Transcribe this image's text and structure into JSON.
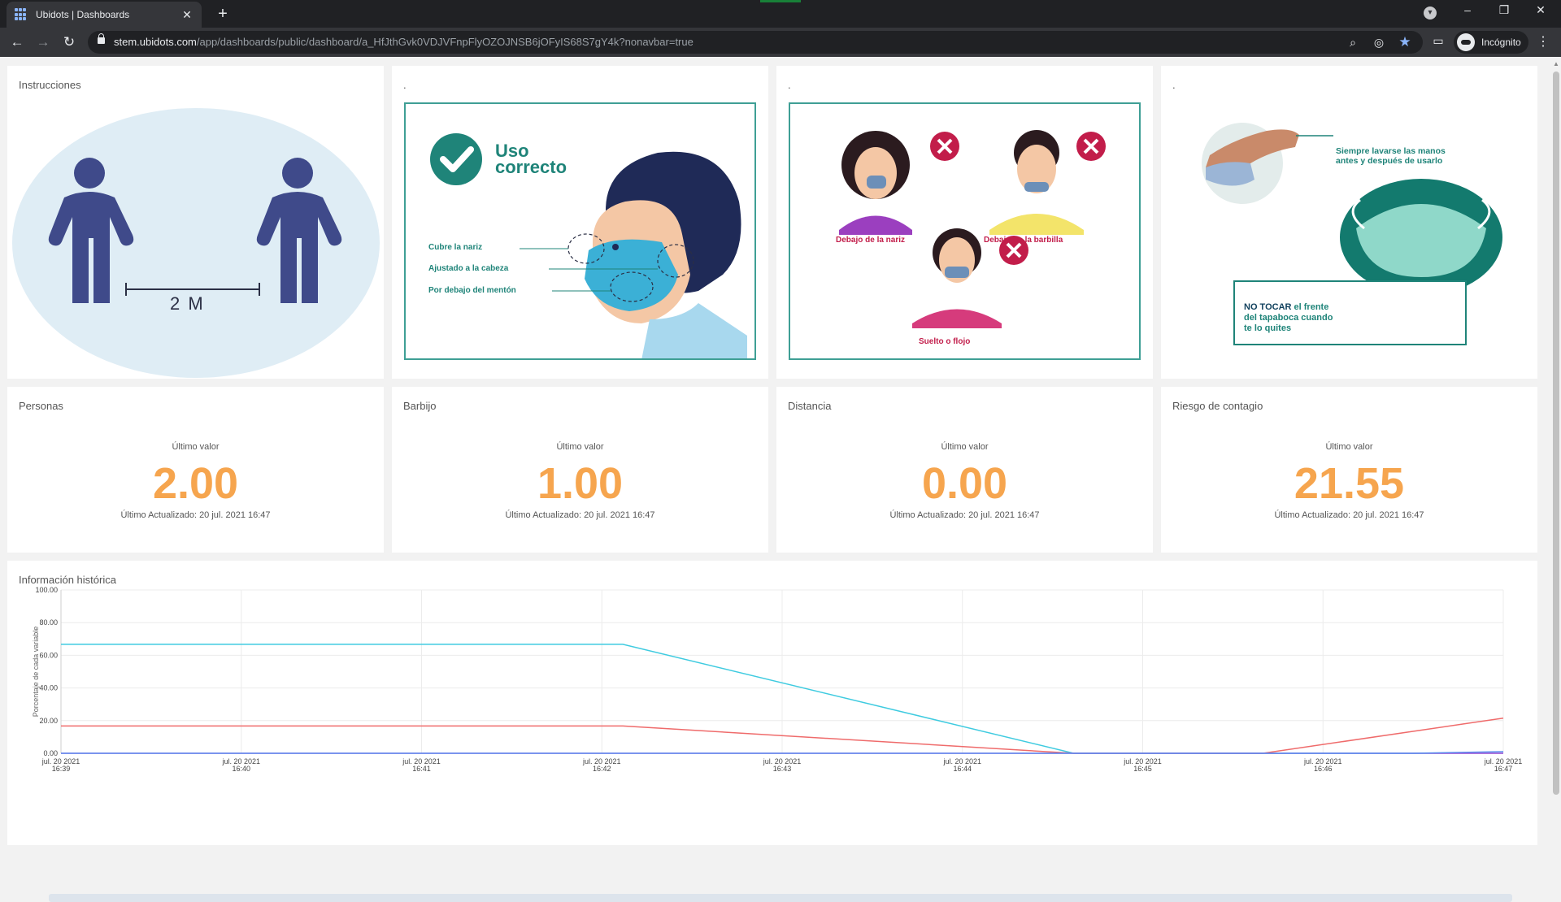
{
  "browser": {
    "tab_title": "Ubidots | Dashboards",
    "tab_close": "✕",
    "new_tab": "+",
    "url_host": "stem.ubidots.com",
    "url_path": "/app/dashboards/public/dashboard/a_HfJthGvk0VDJVFnpFlyOZOJNSB6jOFyIS68S7gY4k?nonavbar=true",
    "profile_label": "Incógnito",
    "window_minimize": "–",
    "window_restore": "❐",
    "window_close": "✕"
  },
  "widgets": {
    "instrucciones": {
      "title": "Instrucciones",
      "distance_label": "2 M"
    },
    "uso_correcto": {
      "title": ".",
      "heading_line1": "Uso",
      "heading_line2": "correcto",
      "label_1": "Cubre la nariz",
      "label_2": "Ajustado a la cabeza",
      "label_3": "Por debajo del mentón"
    },
    "uso_incorrecto": {
      "title": ".",
      "label_1": "Debajo de la nariz",
      "label_2": "Debajo de la barbilla",
      "label_3": "Suelto o flojo"
    },
    "lavado": {
      "title": ".",
      "note_top_1": "Siempre lavarse las manos",
      "note_top_2": "antes y después de usarlo",
      "note_bottom_bold": "NO TOCAR",
      "note_bottom_1": " el frente",
      "note_bottom_2": "del tapaboca cuando",
      "note_bottom_3": "te lo quites"
    }
  },
  "metrics": [
    {
      "title": "Personas",
      "sub": "Último valor",
      "value": "2.00",
      "updated": "Último Actualizado: 20 jul. 2021 16:47"
    },
    {
      "title": "Barbijo",
      "sub": "Último valor",
      "value": "1.00",
      "updated": "Último Actualizado: 20 jul. 2021 16:47"
    },
    {
      "title": "Distancia",
      "sub": "Último valor",
      "value": "0.00",
      "updated": "Último Actualizado: 20 jul. 2021 16:47"
    },
    {
      "title": "Riesgo de contagio",
      "sub": "Último valor",
      "value": "21.55",
      "updated": "Último Actualizado: 20 jul. 2021 16:47"
    }
  ],
  "history": {
    "title": "Información histórica"
  },
  "colors": {
    "accent_value": "#f6a54e",
    "frame_teal": "#3f9f95",
    "series_cyan": "#3fcbe0",
    "series_red": "#ef6b6b",
    "series_purple": "#b04fd6",
    "series_blue": "#5b8def"
  },
  "chart_data": {
    "type": "line",
    "title": "Información histórica",
    "ylabel": "Porcentaje de cada variable",
    "xlabel": "",
    "ylim": [
      0,
      100
    ],
    "y_ticks": [
      "100.00",
      "80.00",
      "60.00",
      "40.00",
      "20.00",
      "0.00"
    ],
    "x_ticks": [
      [
        "jul. 20 2021",
        "16:39"
      ],
      [
        "jul. 20 2021",
        "16:40"
      ],
      [
        "jul. 20 2021",
        "16:41"
      ],
      [
        "jul. 20 2021",
        "16:42"
      ],
      [
        "jul. 20 2021",
        "16:43"
      ],
      [
        "jul. 20 2021",
        "16:44"
      ],
      [
        "jul. 20 2021",
        "16:45"
      ],
      [
        "jul. 20 2021",
        "16:46"
      ],
      [
        "jul. 20 2021",
        "16:47"
      ]
    ],
    "grid": true,
    "series": [
      {
        "color": "#3fcbe0",
        "points": [
          [
            "16:39",
            66.7
          ],
          [
            "16:42:07",
            66.7
          ],
          [
            "16:44:37",
            0
          ],
          [
            "16:45:40",
            0
          ],
          [
            "16:47",
            0
          ]
        ]
      },
      {
        "color": "#ef6b6b",
        "points": [
          [
            "16:39",
            16.7
          ],
          [
            "16:42:07",
            16.7
          ],
          [
            "16:44:37",
            0
          ],
          [
            "16:45:40",
            0
          ],
          [
            "16:47",
            21.55
          ]
        ]
      },
      {
        "color": "#b04fd6",
        "points": [
          [
            "16:39",
            0
          ],
          [
            "16:47",
            0
          ]
        ]
      },
      {
        "color": "#5b8def",
        "points": [
          [
            "16:39",
            0
          ],
          [
            "16:46:30",
            0
          ],
          [
            "16:47",
            1
          ]
        ]
      }
    ]
  }
}
